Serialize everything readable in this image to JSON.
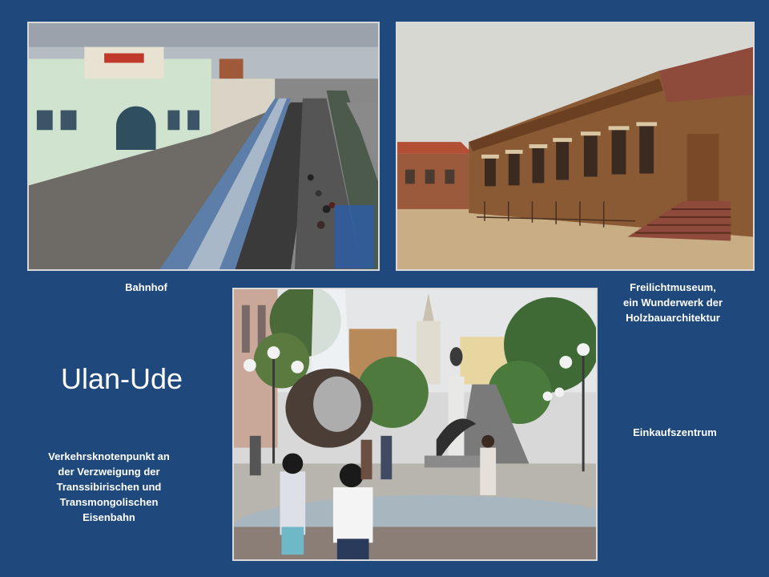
{
  "slide": {
    "title": "Ulan-Ude",
    "background": "#1f497d",
    "text_color": "#ffffff"
  },
  "photos": {
    "station": {
      "caption": "Bahnhof"
    },
    "museum": {
      "caption_lines": [
        "Freilichtmuseum,",
        "ein Wunderwerk der",
        "Holzbauarchitektur"
      ]
    },
    "square": {
      "caption": "Einkaufszentrum"
    }
  },
  "railway_note": {
    "lines": [
      "Verkehrsknotenpunkt an",
      "der Verzweigung der",
      "Transsibirischen und",
      "Transmongolischen",
      "Eisenbahn"
    ]
  }
}
